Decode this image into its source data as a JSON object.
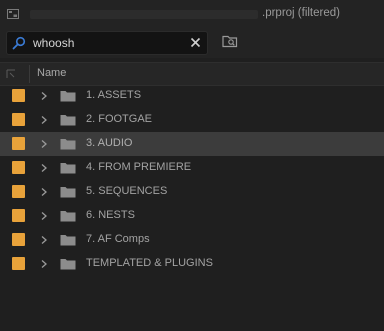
{
  "window": {
    "title": ".prproj (filtered)"
  },
  "search": {
    "value": "whoosh",
    "placeholder": ""
  },
  "header": {
    "name_column": "Name"
  },
  "colors": {
    "label_orange": "#e8a23a",
    "selected_row": "#3c3c3c",
    "folder": "#8c8c8c",
    "search_accent": "#3a7bd5"
  },
  "bins": [
    {
      "label": "1. ASSETS",
      "selected": false
    },
    {
      "label": "2. FOOTGAE",
      "selected": false
    },
    {
      "label": "3. AUDIO",
      "selected": true
    },
    {
      "label": "4. FROM PREMIERE",
      "selected": false
    },
    {
      "label": "5. SEQUENCES",
      "selected": false
    },
    {
      "label": "6. NESTS",
      "selected": false
    },
    {
      "label": "7. AF Comps",
      "selected": false
    },
    {
      "label": "TEMPLATED & PLUGINS",
      "selected": false
    }
  ]
}
